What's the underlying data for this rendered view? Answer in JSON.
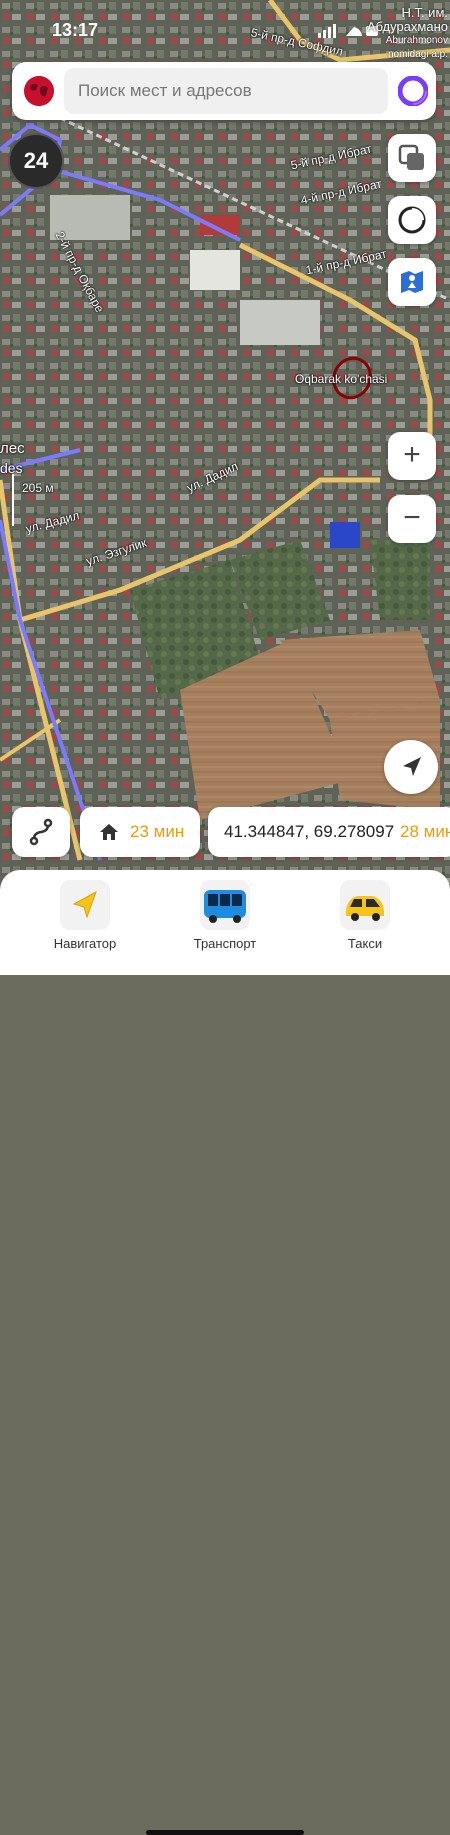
{
  "status": {
    "time": "13:17"
  },
  "map_poi_top": {
    "line1": "Н.Т. им.",
    "line2": "Абдурахмано",
    "line3": "Aburahmonov",
    "line4": "nomidagi a.p."
  },
  "search": {
    "placeholder": "Поиск мест и адресов"
  },
  "badge": {
    "count": "24"
  },
  "map_labels": {
    "street_1": "5-й пр-д Софдил",
    "street_2": "5-й пр-д Ибрат",
    "street_3": "4-й пр-д Ибрат",
    "street_4": "1-й пр-д Ибрат",
    "street_5": "2-й пр-д Оқбаре",
    "street_6": "Oqbarak ko'chasi",
    "street_7": "ул. Дадил",
    "street_8": "ул. Дадил",
    "street_9": "ул. Эзгулик",
    "place_left": "лес",
    "place_left2": "des",
    "scale": "205 м"
  },
  "zoom": {
    "in": "+",
    "out": "−"
  },
  "bottom": {
    "home_time": "23 мин",
    "coords": "41.344847, 69.278097",
    "coords_time": "28 мин"
  },
  "tabs": [
    {
      "label": "Навигатор",
      "icon": "navigator-arrow-icon"
    },
    {
      "label": "Транспорт",
      "icon": "bus-icon"
    },
    {
      "label": "Такси",
      "icon": "taxi-car-icon"
    }
  ],
  "colors": {
    "accent_orange": "#f29b00",
    "route_blue": "#7b7bff",
    "marker_red": "#8b0000"
  }
}
